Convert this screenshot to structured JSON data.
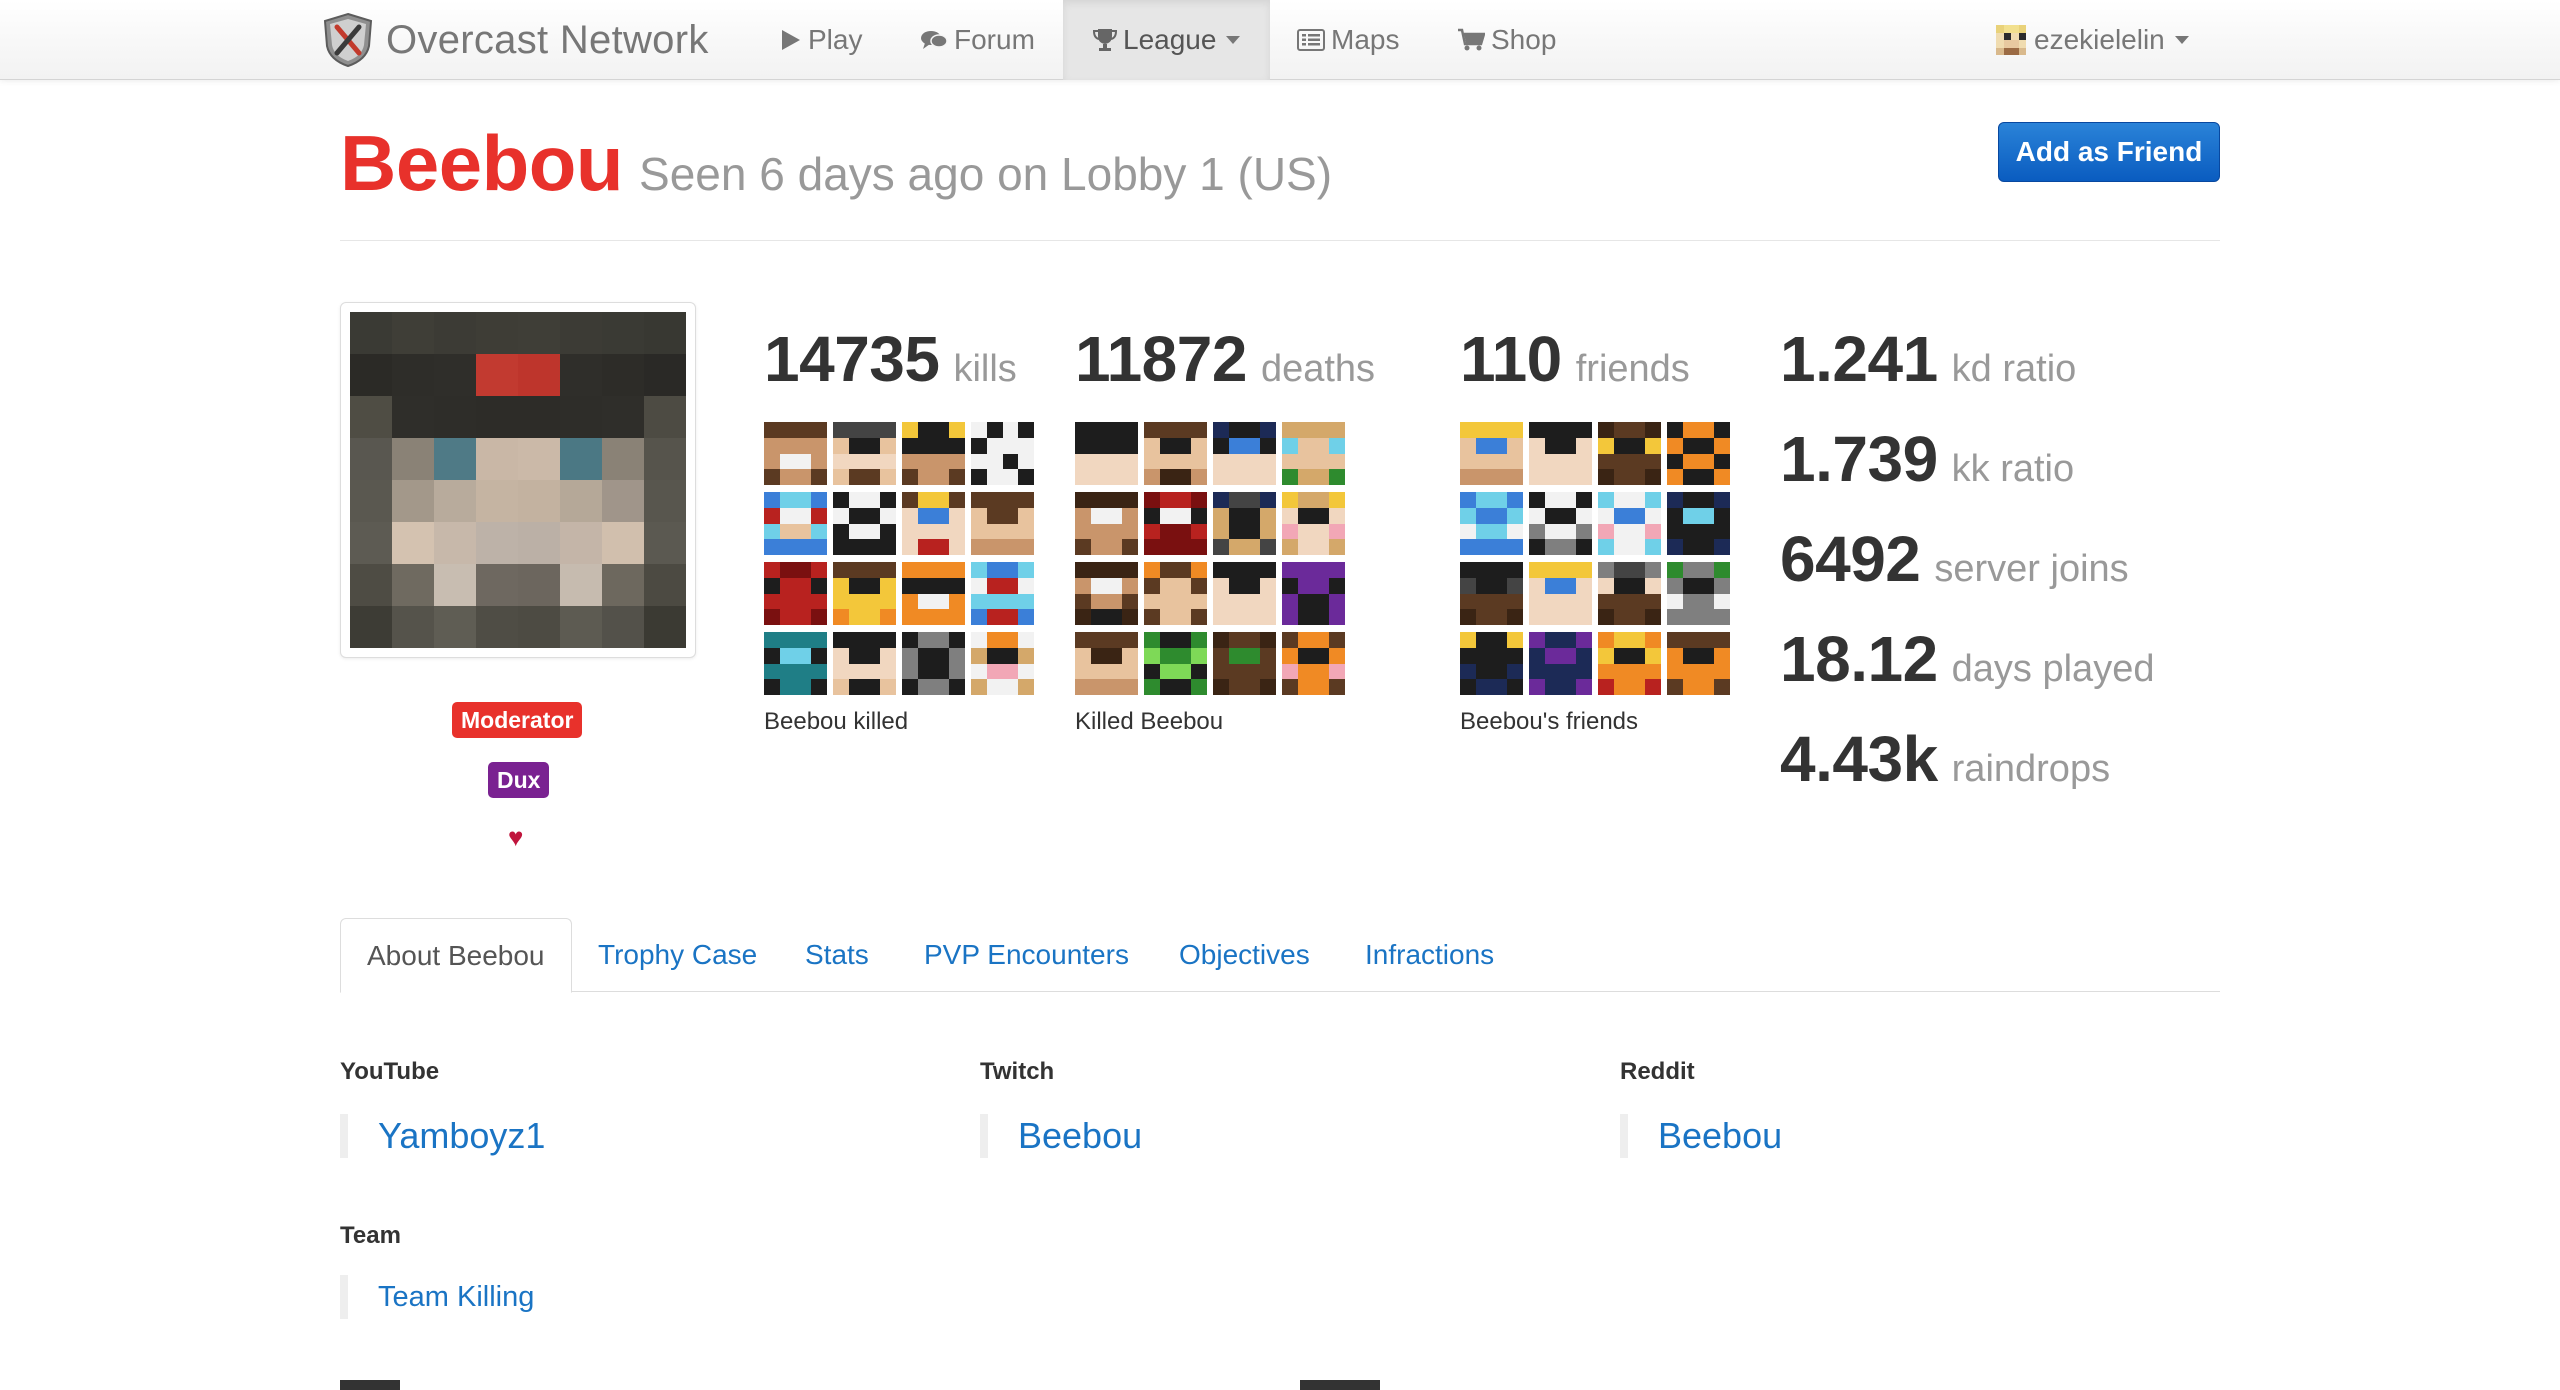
{
  "navbar": {
    "brand": "Overcast Network",
    "items": [
      {
        "label": "Play",
        "icon": "play-icon"
      },
      {
        "label": "Forum",
        "icon": "comments-icon"
      },
      {
        "label": "League",
        "icon": "trophy-icon"
      },
      {
        "label": "Maps",
        "icon": "map-list-icon"
      },
      {
        "label": "Shop",
        "icon": "cart-icon"
      }
    ],
    "user": "ezekielelin"
  },
  "profile": {
    "name": "Beebou",
    "seen": "Seen 6 days ago on Lobby 1 (US)",
    "add_friend": "Add as Friend",
    "badges": [
      "Moderator",
      "Dux"
    ],
    "heart": "♥"
  },
  "stats": {
    "kills": {
      "value": "14735",
      "label": "kills",
      "caption": "Beebou killed"
    },
    "deaths": {
      "value": "11872",
      "label": "deaths",
      "caption": "Killed Beebou"
    },
    "friends": {
      "value": "110",
      "label": "friends",
      "caption": "Beebou's friends"
    },
    "side": [
      {
        "value": "1.241",
        "label": "kd ratio"
      },
      {
        "value": "1.739",
        "label": "kk ratio"
      },
      {
        "value": "6492",
        "label": "server joins"
      },
      {
        "value": "18.12",
        "label": "days played"
      },
      {
        "value": "4.43k",
        "label": "raindrops"
      }
    ]
  },
  "tabs": [
    "About Beebou",
    "Trophy Case",
    "Stats",
    "PVP Encounters",
    "Objectives",
    "Infractions"
  ],
  "about": {
    "youtube": {
      "label": "YouTube",
      "value": "Yamboyz1"
    },
    "twitch": {
      "label": "Twitch",
      "value": "Beebou"
    },
    "reddit": {
      "label": "Reddit",
      "value": "Beebou"
    },
    "team": {
      "label": "Team",
      "value": "Team Killing"
    }
  },
  "colors": {
    "name_red": "#e8312b",
    "link_blue": "#1a74c4",
    "moderator_badge": "#e8312b",
    "dux_badge": "#7a2291",
    "button_blue": "#1467cc"
  }
}
